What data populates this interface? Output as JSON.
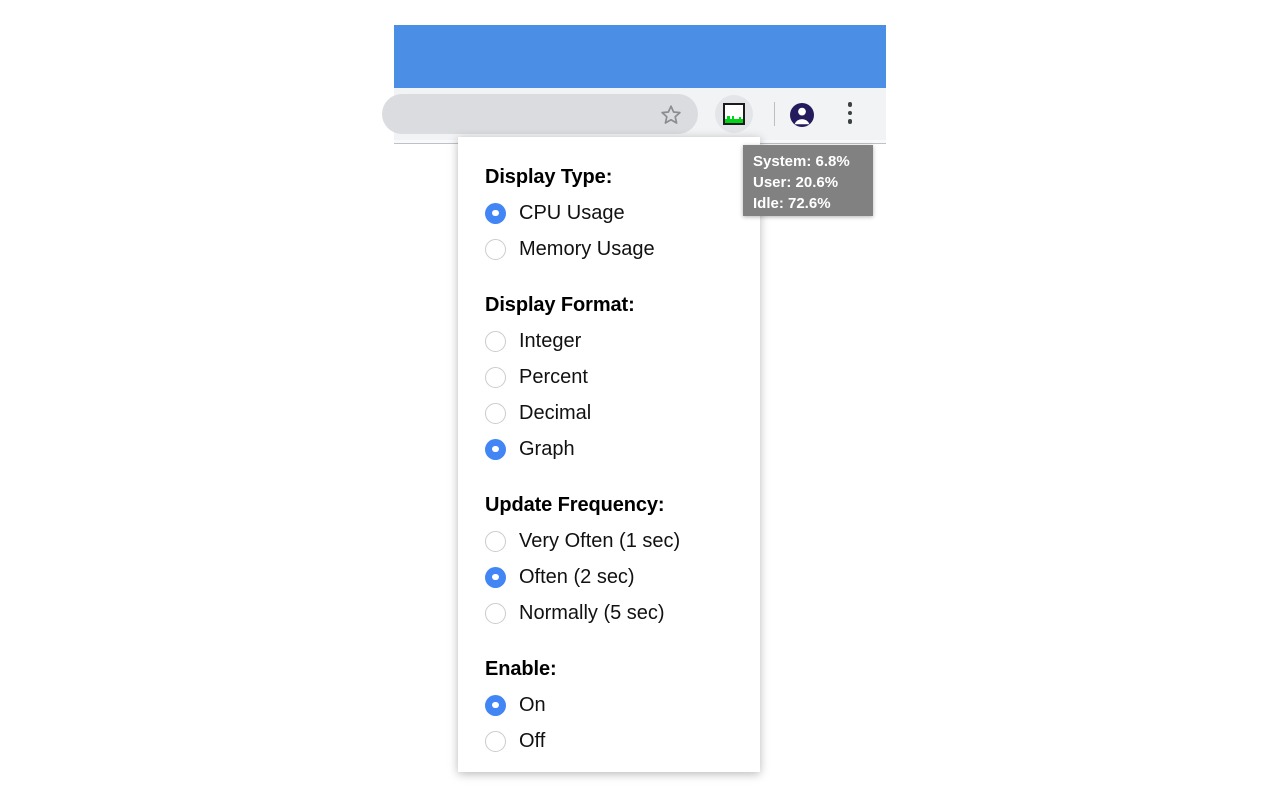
{
  "browser": {
    "tabstrip_color": "#4a8ee6",
    "toolbar_color": "#f1f3f4",
    "omnibox_color": "#dadce0",
    "icons": {
      "bookmark_star": "star-icon",
      "extension_action": "cpu-graph-icon",
      "profile": "profile-avatar-icon",
      "menu": "three-dot-menu-icon"
    }
  },
  "tooltip": {
    "lines": [
      "System: 6.8%",
      "User: 20.6%",
      "Idle: 72.6%"
    ],
    "background_color": "#818181",
    "text_color": "#ffffff"
  },
  "popup": {
    "accent_color": "#4285f4",
    "groups": [
      {
        "title": "Display Type:",
        "name": "display-type",
        "options": [
          {
            "label": "CPU Usage",
            "selected": true
          },
          {
            "label": "Memory Usage",
            "selected": false
          }
        ]
      },
      {
        "title": "Display Format:",
        "name": "display-format",
        "options": [
          {
            "label": "Integer",
            "selected": false
          },
          {
            "label": "Percent",
            "selected": false
          },
          {
            "label": "Decimal",
            "selected": false
          },
          {
            "label": "Graph",
            "selected": true
          }
        ]
      },
      {
        "title": "Update Frequency:",
        "name": "update-frequency",
        "options": [
          {
            "label": "Very Often (1 sec)",
            "selected": false
          },
          {
            "label": "Often (2 sec)",
            "selected": true
          },
          {
            "label": "Normally (5 sec)",
            "selected": false
          }
        ]
      },
      {
        "title": "Enable:",
        "name": "enable",
        "options": [
          {
            "label": "On",
            "selected": true
          },
          {
            "label": "Off",
            "selected": false
          }
        ]
      }
    ]
  },
  "extension_icon": {
    "bar_color": "#00d318",
    "bar_heights": [
      4,
      7,
      4,
      7,
      4,
      4,
      6,
      4
    ]
  }
}
